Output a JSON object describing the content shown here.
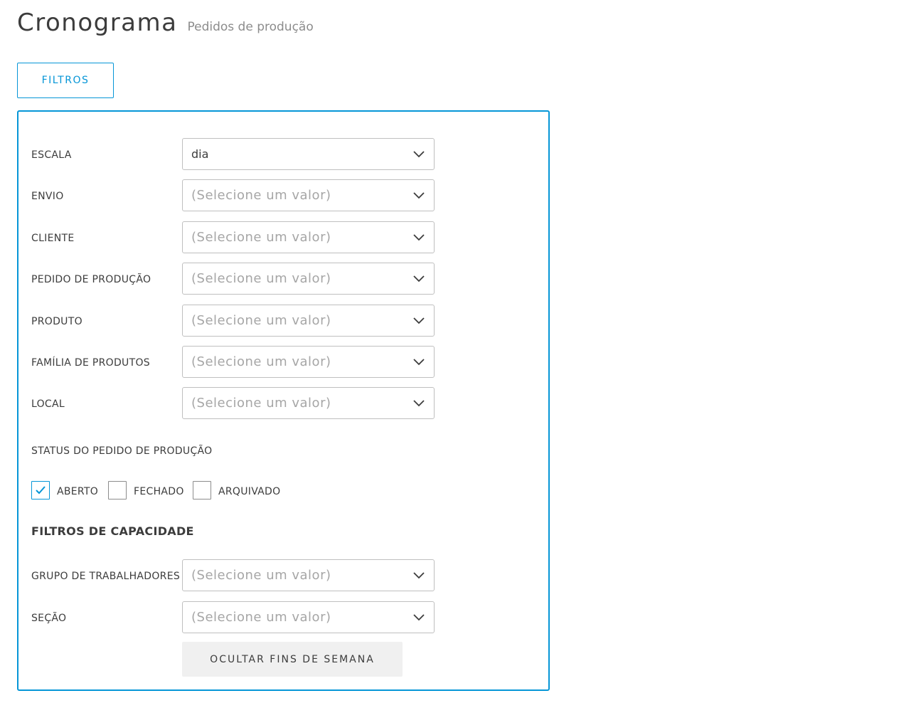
{
  "header": {
    "title": "Cronograma",
    "subtitle": "Pedidos de produção"
  },
  "toolbar": {
    "filters_label": "FILTROS"
  },
  "filters": {
    "escala": {
      "label": "ESCALA",
      "value": "dia"
    },
    "envio": {
      "label": "ENVIO",
      "placeholder": "(Selecione um valor)"
    },
    "cliente": {
      "label": "CLIENTE",
      "placeholder": "(Selecione um valor)"
    },
    "pedido": {
      "label": "PEDIDO DE PRODUÇÃO",
      "placeholder": "(Selecione um valor)"
    },
    "produto": {
      "label": "PRODUTO",
      "placeholder": "(Selecione um valor)"
    },
    "familia": {
      "label": "FAMÍLIA DE PRODUTOS",
      "placeholder": "(Selecione um valor)"
    },
    "local": {
      "label": "LOCAL",
      "placeholder": "(Selecione um valor)"
    }
  },
  "status": {
    "label": "STATUS DO PEDIDO DE PRODUÇÃO",
    "options": [
      {
        "label": "ABERTO",
        "checked": true
      },
      {
        "label": "FECHADO",
        "checked": false
      },
      {
        "label": "ARQUIVADO",
        "checked": false
      }
    ]
  },
  "capacity": {
    "heading": "FILTROS DE CAPACIDADE",
    "grupo": {
      "label": "GRUPO DE TRABALHADORES",
      "placeholder": "(Selecione um valor)"
    },
    "secao": {
      "label": "SEÇÃO",
      "placeholder": "(Selecione um valor)"
    },
    "hide_weekends_label": "OCULTAR FINS DE SEMANA"
  },
  "colors": {
    "accent": "#0696d7",
    "border": "#bfbfbf",
    "placeholder": "#a6a6a6"
  },
  "icons": {
    "chevron": "chevron-down-icon",
    "check": "checkmark-icon"
  }
}
